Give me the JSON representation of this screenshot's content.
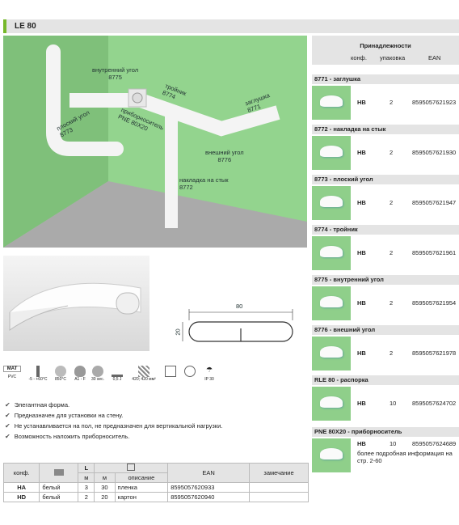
{
  "title": "LE 80",
  "photo_labels": [
    {
      "text": "внутренний угол\n8775"
    },
    {
      "text": "тройник\n8774"
    },
    {
      "text": "заглушка\n8771"
    },
    {
      "text": "плоский угол\n8773"
    },
    {
      "text": "приборноситель\nPNE 80X20"
    },
    {
      "text": "внешний угол\n8776"
    },
    {
      "text": "накладка на стык\n8772"
    }
  ],
  "profile": {
    "width": "80",
    "height": "20"
  },
  "pictograms": [
    "MAT",
    "PVC",
    "-5 - +60°C",
    "850°C",
    "A1 - F",
    "30 sec.",
    "0,5 J",
    "420; 420 мм²",
    "IP 30"
  ],
  "features": [
    "Элегантная форма.",
    "Предназначен для установки на стену.",
    "Не устанавливается на пол, не предназначен для вертикальной нагрузки.",
    "Возможность наложить приборноситель."
  ],
  "main_table": {
    "headers": [
      "конф.",
      "L",
      "EAN",
      "замечание"
    ],
    "subheaders": [
      "м",
      "м",
      "описание"
    ],
    "rows": [
      {
        "konf": "HA",
        "color": "белый",
        "l": "3",
        "m": "30",
        "desc": "пленка",
        "ean": "8595057620933",
        "note": ""
      },
      {
        "konf": "HD",
        "color": "белый",
        "l": "2",
        "m": "20",
        "desc": "картон",
        "ean": "8595057620940",
        "note": ""
      }
    ]
  },
  "accessories": {
    "header": "Принадлежности",
    "cols": [
      "конф.",
      "упаковка",
      "EAN"
    ],
    "items": [
      {
        "title": "8771 - заглушка",
        "konf": "HB",
        "pack": "2",
        "ean": "8595057621923"
      },
      {
        "title": "8772 - накладка на стык",
        "konf": "HB",
        "pack": "2",
        "ean": "8595057621930"
      },
      {
        "title": "8773 - плоский угол",
        "konf": "HB",
        "pack": "2",
        "ean": "8595057621947"
      },
      {
        "title": "8774 - тройник",
        "konf": "HB",
        "pack": "2",
        "ean": "8595057621961"
      },
      {
        "title": "8775 - внутренний угол",
        "konf": "HB",
        "pack": "2",
        "ean": "8595057621954"
      },
      {
        "title": "8776 - внешний угол",
        "konf": "HB",
        "pack": "2",
        "ean": "8595057621978"
      },
      {
        "title": "RLE 80 - распорка",
        "konf": "HB",
        "pack": "10",
        "ean": "8595057624702"
      },
      {
        "title": "PNE 80X20 - приборноситель",
        "konf": "HB",
        "pack": "10",
        "ean": "8595057624689",
        "note": "более подробная информация на стр. 2-60"
      }
    ]
  },
  "colors": {
    "accent": "#76b82a",
    "wall": "#8fcf8a",
    "header_bg": "#e4e4e4"
  }
}
